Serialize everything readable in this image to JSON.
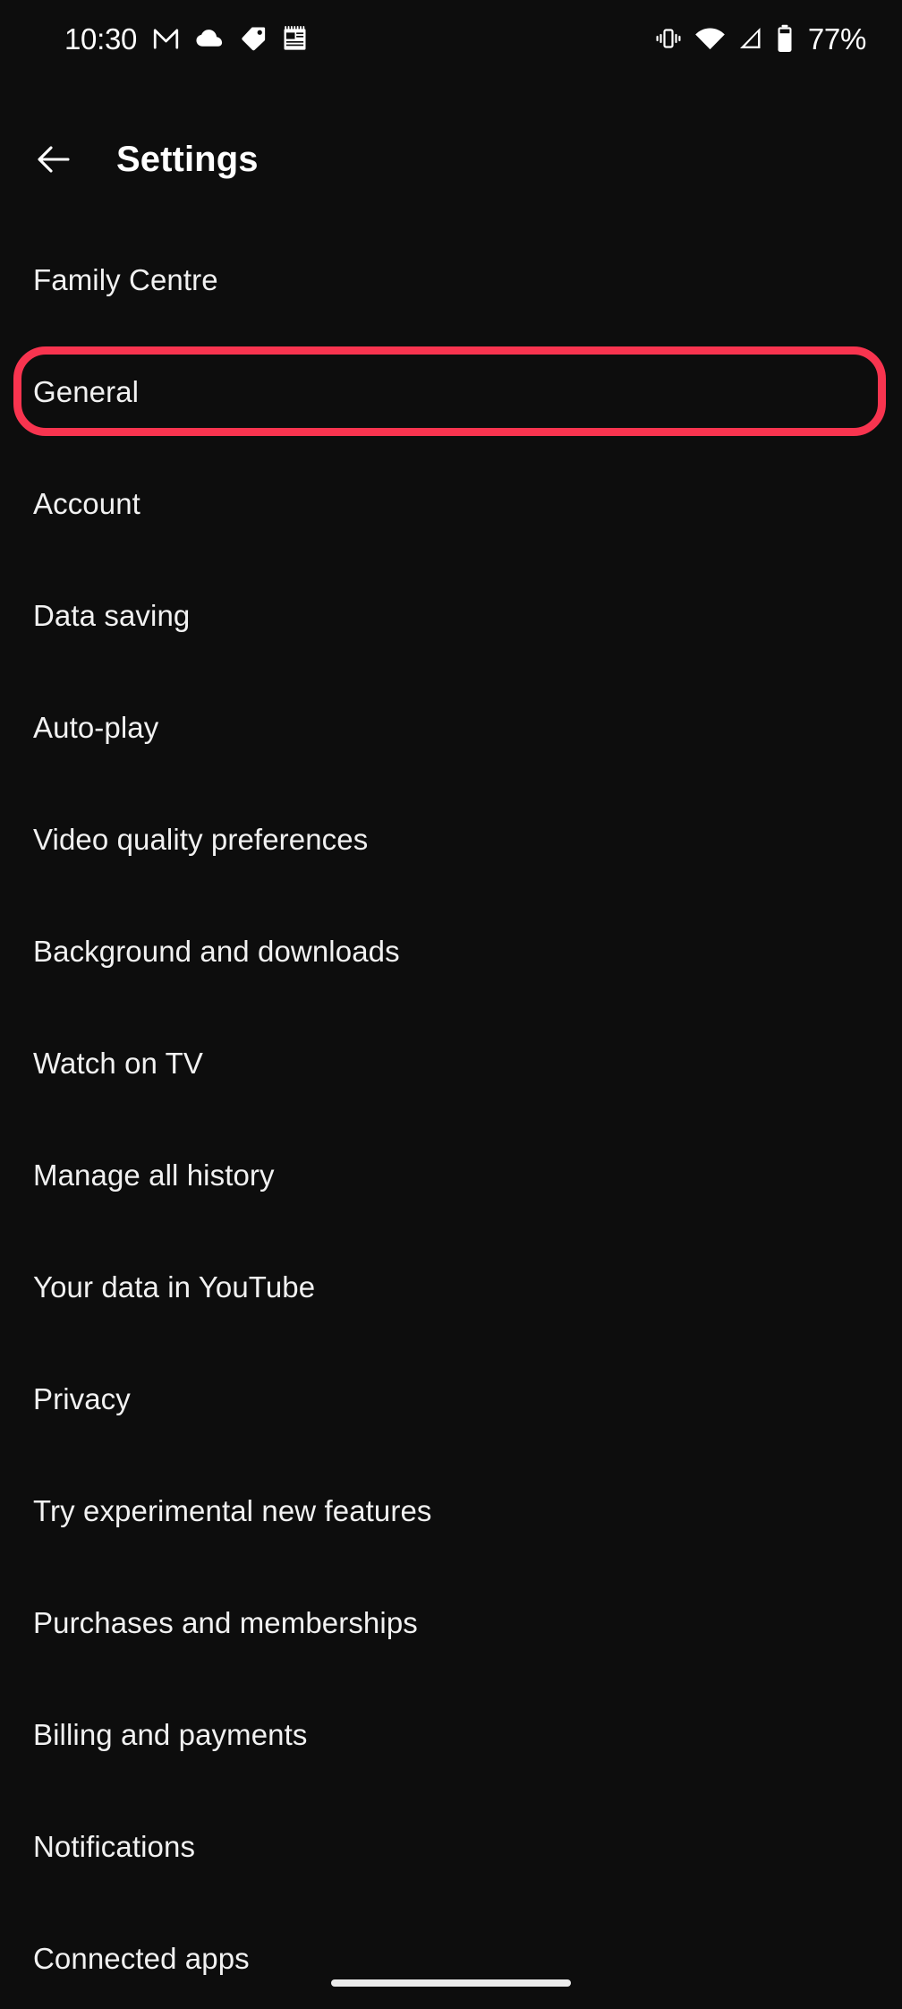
{
  "status_bar": {
    "clock": "10:30",
    "battery_percent": "77%",
    "left_icons": [
      {
        "name": "gmail-icon",
        "label": "M"
      },
      {
        "name": "cloud-icon",
        "label": "cloud"
      },
      {
        "name": "tag-icon",
        "label": "tag"
      },
      {
        "name": "notepad-icon",
        "label": "notepad"
      }
    ],
    "right_icons": [
      {
        "name": "vibrate-icon",
        "label": "vibrate"
      },
      {
        "name": "wifi-icon",
        "label": "wifi"
      },
      {
        "name": "cellular-signal-icon",
        "label": "signal"
      },
      {
        "name": "battery-icon",
        "label": "battery"
      }
    ]
  },
  "app_bar": {
    "back_label": "Back",
    "title": "Settings"
  },
  "settings": {
    "items": [
      {
        "label": "Family Centre",
        "highlighted": false
      },
      {
        "label": "General",
        "highlighted": true
      },
      {
        "label": "Account",
        "highlighted": false
      },
      {
        "label": "Data saving",
        "highlighted": false
      },
      {
        "label": "Auto-play",
        "highlighted": false
      },
      {
        "label": "Video quality preferences",
        "highlighted": false
      },
      {
        "label": "Background and downloads",
        "highlighted": false
      },
      {
        "label": "Watch on TV",
        "highlighted": false
      },
      {
        "label": "Manage all history",
        "highlighted": false
      },
      {
        "label": "Your data in YouTube",
        "highlighted": false
      },
      {
        "label": "Privacy",
        "highlighted": false
      },
      {
        "label": "Try experimental new features",
        "highlighted": false
      },
      {
        "label": "Purchases and memberships",
        "highlighted": false
      },
      {
        "label": "Billing and payments",
        "highlighted": false
      },
      {
        "label": "Notifications",
        "highlighted": false
      },
      {
        "label": "Connected apps",
        "highlighted": false
      }
    ]
  },
  "colors": {
    "background": "#0d0d0d",
    "text_primary": "#f1f1f1",
    "highlight_red": "#f8344f",
    "gesture_bar": "#ececec"
  },
  "navigation": {
    "gesture_bar_label": "home-gesture-bar"
  }
}
